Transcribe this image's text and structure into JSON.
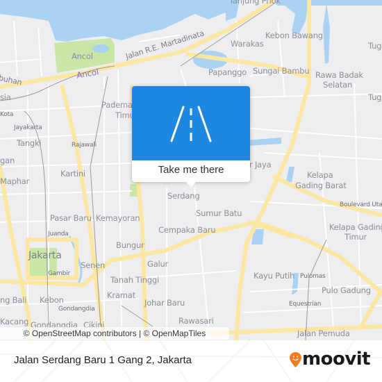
{
  "map": {
    "colors": {
      "water": "#aad3f3",
      "park": "#c8e6a8",
      "major_road": "#fbe7a1",
      "minor_road": "#ffffff",
      "land": "#eeeef0",
      "popup_blue": "#1e87df",
      "moovit_orange": "#f47b20"
    },
    "labels": {
      "tanjung_priok": "Tanjung Priok",
      "kebon_bawang": "Kebon Bawang",
      "warakas": "Warakas",
      "papanggo": "Papanggo",
      "sungai_bambu": "Sungai Bambu",
      "rawa_badak": "Rawa Badak",
      "selatan": "Selatan",
      "tug1": "Tug",
      "tug2": "Tug",
      "ancol_park": "Ancol",
      "ancol_road": "Ancol",
      "martadinata": "Jalan R.E. Martadinata",
      "buhan": "buhan",
      "asia": "sia",
      "kota": "Kota",
      "jayakarta": "Jayakarta",
      "tangki": "Tangki",
      "rajawali": "Rajawali",
      "pademangan": "Padema",
      "timur": "Timu",
      "gan": "gan",
      "maphar": "Maphar",
      "kartini": "Kartini",
      "jaya": "r Jaya",
      "kelapa_gading_barat_1": "Kelapa",
      "kelapa_gading_barat_2": "Gading Barat",
      "boulevard_utara": "Boulevard Utar",
      "kelapa_gading_timur_1": "Kelapa Gading",
      "kelapa_gading_timur_2": "Timur",
      "serdang": "Serdang",
      "sumur_batu": "Sumur Batu",
      "cempaka_baru": "Cempaka Baru",
      "pasar_baru": "Pasar Baru",
      "kemayoran": "Kemayoran",
      "juanda": "Juanda",
      "bungur": "Bungur",
      "jakarta": "Jakarta",
      "senen": "Senen",
      "gambir": "Gambir",
      "galur": "Galur",
      "tanah_tinggi": "Tanah Tinggi",
      "kayu_putih": "Kayu Putih",
      "pulomas": "Pulomas",
      "pulo_gadung": "Pulo Gadung",
      "equestrian": "Equestrian",
      "kramat": "Kramat",
      "johar_baru": "Johar Baru",
      "ng_bali": "ng Bali",
      "kebon": "Kebon",
      "gondangdia_s": "Gondangdia",
      "kacang": "Kacang",
      "gondangdia": "Gondangdia",
      "cikini": "Cikini",
      "rawasari": "Rawasari",
      "jalan_pemuda": "Jalan Pemuda"
    },
    "attribution": "© OpenStreetMap contributors | © OpenMapTiles"
  },
  "popup": {
    "icon": "road-icon",
    "button_label": "Take me there"
  },
  "footer": {
    "address": "Jalan Serdang Baru 1 Gang 2, Jakarta",
    "brand": "moovit",
    "brand_icon": "moovit-pin-icon"
  }
}
